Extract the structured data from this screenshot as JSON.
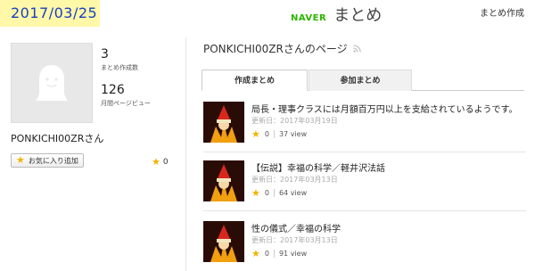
{
  "date_stamp": "2017/03/25",
  "header": {
    "logo_naver": "NAVER",
    "logo_matome": "まとめ",
    "create_link": "まとめ作成"
  },
  "profile": {
    "created_count": "3",
    "created_label": "まとめ作成数",
    "monthly_views": "126",
    "monthly_views_label": "月間ページビュー",
    "username": "PONKICHI00ZRさん",
    "fav_button_label": "お気に入り追加",
    "fav_count": "0"
  },
  "page": {
    "title": "PONKICHI00ZRさんのページ",
    "tabs": [
      {
        "label": "作成まとめ",
        "active": true
      },
      {
        "label": "参加まとめ",
        "active": false
      }
    ]
  },
  "items": [
    {
      "title": "局長・理事クラスには月額百万円以上を支給されているようです。",
      "date": "更新日：2017年03月19日",
      "stars": "0",
      "views": "37 view"
    },
    {
      "title": "【伝説】幸福の科学／軽井沢法話",
      "date": "更新日：2017年03月13日",
      "stars": "0",
      "views": "64 view"
    },
    {
      "title": "性の儀式／幸福の科学",
      "date": "更新日：2017年03月13日",
      "stars": "0",
      "views": "91 view"
    }
  ],
  "colors": {
    "date_stamp_bg": "#fff8a8",
    "date_stamp_text": "#1a3fbf",
    "naver_green": "#2db400",
    "star": "#f0b400"
  },
  "icons": [
    "user-silhouette-icon",
    "star-icon",
    "rss-icon"
  ]
}
